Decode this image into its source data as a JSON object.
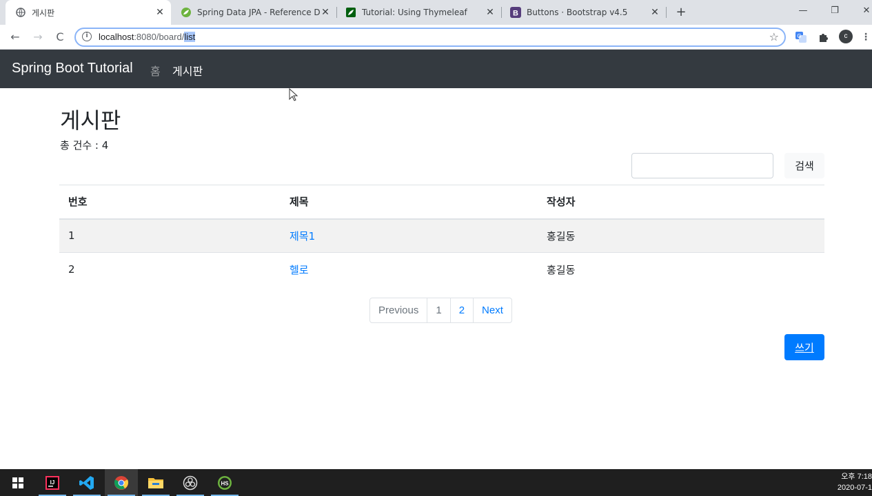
{
  "browser": {
    "tabs": [
      {
        "title": "게시판",
        "active": true
      },
      {
        "title": "Spring Data JPA - Reference Do",
        "active": false
      },
      {
        "title": "Tutorial: Using Thymeleaf",
        "active": false
      },
      {
        "title": "Buttons · Bootstrap v4.5",
        "active": false
      }
    ],
    "url_host": "localhost",
    "url_port_path": ":8080/board/",
    "url_selected": "list"
  },
  "app": {
    "brand": "Spring Boot Tutorial",
    "nav": [
      {
        "label": "홈",
        "active": false
      },
      {
        "label": "게시판",
        "active": true
      }
    ]
  },
  "main": {
    "title": "게시판",
    "count_label": "총 건수 : 4",
    "search_button": "검색",
    "search_placeholder": "",
    "columns": [
      "번호",
      "제목",
      "작성자"
    ],
    "rows": [
      {
        "no": "1",
        "title": "제목1",
        "author": "홍길동"
      },
      {
        "no": "2",
        "title": "헬로",
        "author": "홍길동"
      }
    ],
    "pagination": {
      "previous": "Previous",
      "pages": [
        "1",
        "2"
      ],
      "next": "Next"
    },
    "write_button": "쓰기"
  },
  "taskbar": {
    "time": "오후 7:18",
    "date": "2020-07-1"
  },
  "colors": {
    "navbar_bg": "#343a40",
    "primary": "#007bff",
    "stripe": "#f2f2f2"
  }
}
